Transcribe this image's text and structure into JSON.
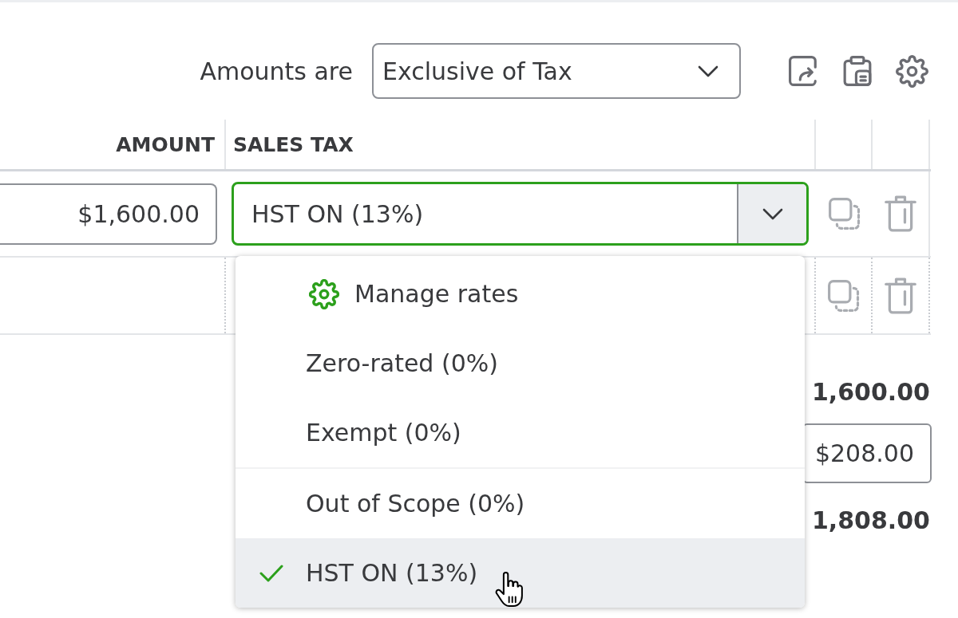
{
  "toolbar": {
    "amounts_label": "Amounts are",
    "amounts_select": {
      "value": "Exclusive of Tax"
    }
  },
  "table": {
    "columns": [
      "AMOUNT",
      "SALES TAX"
    ],
    "rows": [
      {
        "kind": "entry",
        "amount": "$1,600.00",
        "sales_tax": {
          "value": "HST ON (13%)",
          "expanded": true,
          "menu": {
            "groups": [
              {
                "items": [
                  {
                    "kind": "action",
                    "label": "Manage rates"
                  },
                  {
                    "kind": "option",
                    "label": "Zero-rated (0%)",
                    "selected": false,
                    "hovered": false
                  },
                  {
                    "kind": "option",
                    "label": "Exempt (0%)",
                    "selected": false,
                    "hovered": false
                  }
                ]
              },
              {
                "items": [
                  {
                    "kind": "option",
                    "label": "Out of Scope (0%)",
                    "selected": false,
                    "hovered": false
                  },
                  {
                    "kind": "option",
                    "label": "HST ON (13%)",
                    "selected": true,
                    "hovered": true
                  }
                ]
              }
            ]
          }
        }
      },
      {
        "kind": "blank"
      }
    ]
  },
  "totals": [
    {
      "kind": "text",
      "value": "1,600.00"
    },
    {
      "kind": "input",
      "value": "$208.00"
    },
    {
      "kind": "text",
      "value": "1,808.00"
    }
  ]
}
